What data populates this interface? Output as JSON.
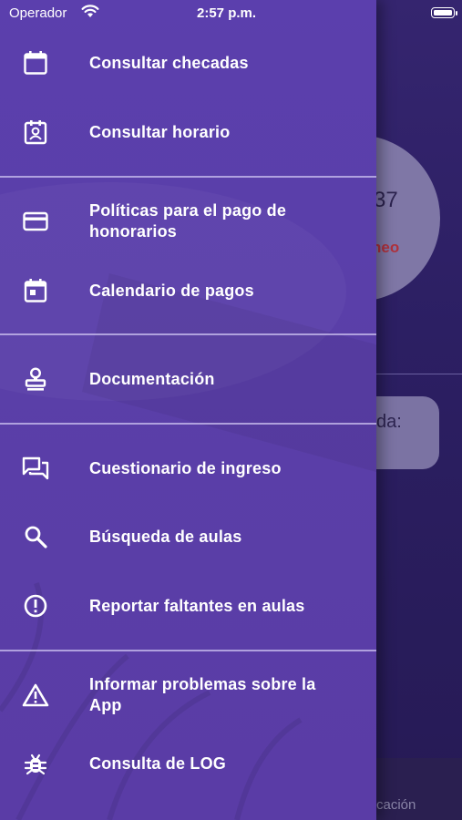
{
  "status_bar": {
    "carrier": "Operador",
    "time": "2:57 p.m."
  },
  "background": {
    "circle_number": "37",
    "circle_red_text": "neo",
    "card_text": "da:",
    "bottom_tab_text": "cación"
  },
  "drawer": {
    "items": [
      {
        "label": "Consultar checadas",
        "icon": "calendar-icon"
      },
      {
        "label": "Consultar horario",
        "icon": "badge-icon"
      },
      {
        "label": "Políticas para el pago de honorarios",
        "icon": "credit-card-icon"
      },
      {
        "label": "Calendario de pagos",
        "icon": "calendar-event-icon"
      },
      {
        "label": "Documentación",
        "icon": "stamp-icon"
      },
      {
        "label": "Cuestionario de ingreso",
        "icon": "chat-icon"
      },
      {
        "label": "Búsqueda de aulas",
        "icon": "search-icon"
      },
      {
        "label": "Reportar faltantes en aulas",
        "icon": "alert-circle-icon"
      },
      {
        "label": "Informar problemas sobre la App",
        "icon": "warning-icon"
      },
      {
        "label": "Consulta de LOG",
        "icon": "bug-icon"
      }
    ]
  },
  "colors": {
    "drawer": "#5b3fad",
    "separator": "#cdc3f0",
    "text": "#ffffff"
  }
}
